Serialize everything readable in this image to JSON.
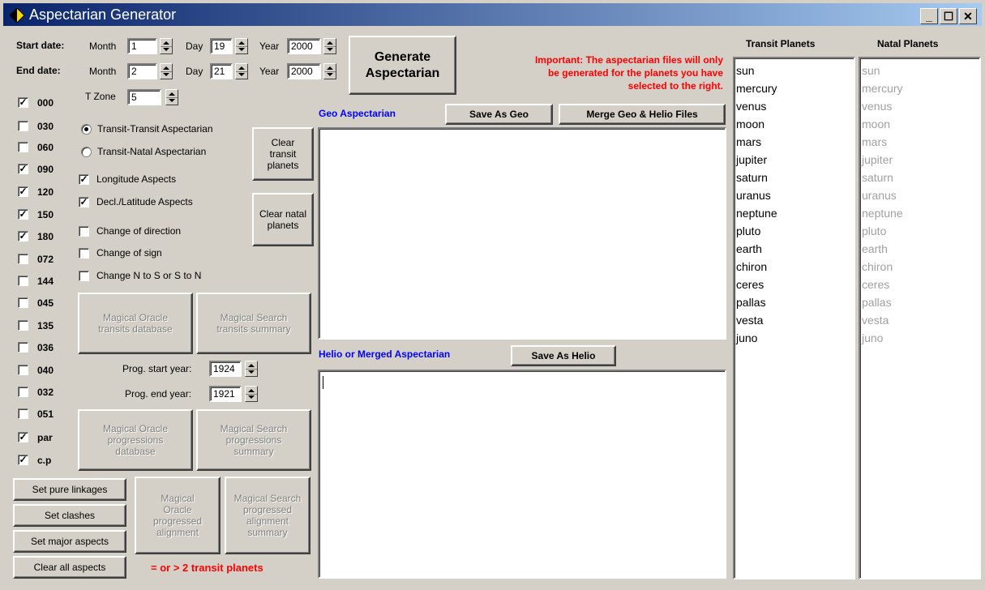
{
  "window": {
    "title": "Aspectarian Generator"
  },
  "start_date": {
    "label": "Start date:",
    "month_label": "Month",
    "month": "1",
    "day_label": "Day",
    "day": "19",
    "year_label": "Year",
    "year": "2000"
  },
  "end_date": {
    "label": "End date:",
    "month_label": "Month",
    "month": "2",
    "day_label": "Day",
    "day": "21",
    "year_label": "Year",
    "year": "2000"
  },
  "tzone": {
    "label": "T Zone",
    "value": "5"
  },
  "generate_button": "Generate Aspectarian",
  "important_note": [
    "Important: The aspectarian files will only",
    "be generated for the planets you have",
    "selected to the right."
  ],
  "aspects": [
    {
      "label": "000",
      "checked": true
    },
    {
      "label": "030",
      "checked": false
    },
    {
      "label": "060",
      "checked": false
    },
    {
      "label": "090",
      "checked": true
    },
    {
      "label": "120",
      "checked": true
    },
    {
      "label": "150",
      "checked": true
    },
    {
      "label": "180",
      "checked": true
    },
    {
      "label": "072",
      "checked": false
    },
    {
      "label": "144",
      "checked": false
    },
    {
      "label": "045",
      "checked": false
    },
    {
      "label": "135",
      "checked": false
    },
    {
      "label": "036",
      "checked": false
    },
    {
      "label": "040",
      "checked": false
    },
    {
      "label": "032",
      "checked": false
    },
    {
      "label": "051",
      "checked": false
    },
    {
      "label": "par",
      "checked": true
    },
    {
      "label": "c.p",
      "checked": true
    }
  ],
  "radios": {
    "transit_transit": "Transit-Transit Aspectarian",
    "transit_natal": "Transit-Natal Aspectarian"
  },
  "options": {
    "longitude": "Longitude Aspects",
    "decl": "Decl./Latitude Aspects",
    "direction": "Change of direction",
    "sign": "Change of sign",
    "ns": "Change N to S or S to N"
  },
  "clear_transit": "Clear transit planets",
  "clear_natal": "Clear natal planets",
  "oracle_transits": "Magical Oracle transits database",
  "search_transits": "Magical Search transits summary",
  "prog_start": {
    "label": "Prog. start year:",
    "value": "1924"
  },
  "prog_end": {
    "label": "Prog. end year:",
    "value": "1921"
  },
  "oracle_prog": "Magical Oracle progressions database",
  "search_prog": "Magical Search progressions summary",
  "set_pure": "Set pure linkages",
  "set_clashes": "Set clashes",
  "set_major": "Set major aspects",
  "clear_all": "Clear all aspects",
  "oracle_aligned": "Magical Oracle progressed alignment",
  "search_aligned": "Magical Search progressed alignment summary",
  "transit_note": "= or > 2 transit planets",
  "geo_label": "Geo Aspectarian",
  "save_geo": "Save As Geo",
  "merge": "Merge Geo & Helio Files",
  "helio_label": "Helio or Merged Aspectarian",
  "save_helio": "Save As Helio",
  "transit_header": "Transit Planets",
  "natal_header": "Natal Planets",
  "planets": [
    "sun",
    "mercury",
    "venus",
    "moon",
    "mars",
    "jupiter",
    "saturn",
    "uranus",
    "neptune",
    "pluto",
    "earth",
    "chiron",
    "ceres",
    "pallas",
    "vesta",
    "juno"
  ]
}
